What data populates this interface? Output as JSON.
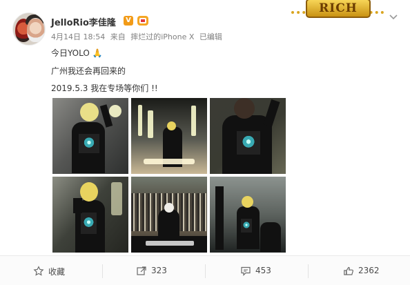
{
  "user": {
    "name": "JelloRio李佳隆",
    "verified_badge": "V"
  },
  "post": {
    "meta": {
      "date": "4月14日 18:54",
      "source_prefix": "来自",
      "device": "摔烂过的iPhone X",
      "edited": "已编辑"
    },
    "lines": [
      "今日YOLO 🙏",
      "广州我还会再回来的",
      "2019.5.3 我在专场等你们 !!"
    ],
    "decoration": {
      "text": "RICH"
    },
    "photos": [
      {
        "name": "performer-on-stage"
      },
      {
        "name": "wide-stage-shot"
      },
      {
        "name": "performer-with-microphone"
      },
      {
        "name": "performer-with-blonde-hair"
      },
      {
        "name": "crowd-performance"
      },
      {
        "name": "performer-on-platform"
      }
    ]
  },
  "actions": {
    "favorite": {
      "label": "收藏"
    },
    "forward": {
      "count": "323"
    },
    "comment": {
      "count": "453"
    },
    "like": {
      "count": "2362"
    }
  },
  "colors": {
    "verified_badge": "#f29b18",
    "accent_text": "#4a4a4a",
    "divider": "#e2e2e2"
  },
  "icons": {
    "favorite": "star-icon",
    "forward": "share-icon",
    "comment": "comment-icon",
    "like": "thumbs-up-icon",
    "more": "chevron-down-icon"
  }
}
